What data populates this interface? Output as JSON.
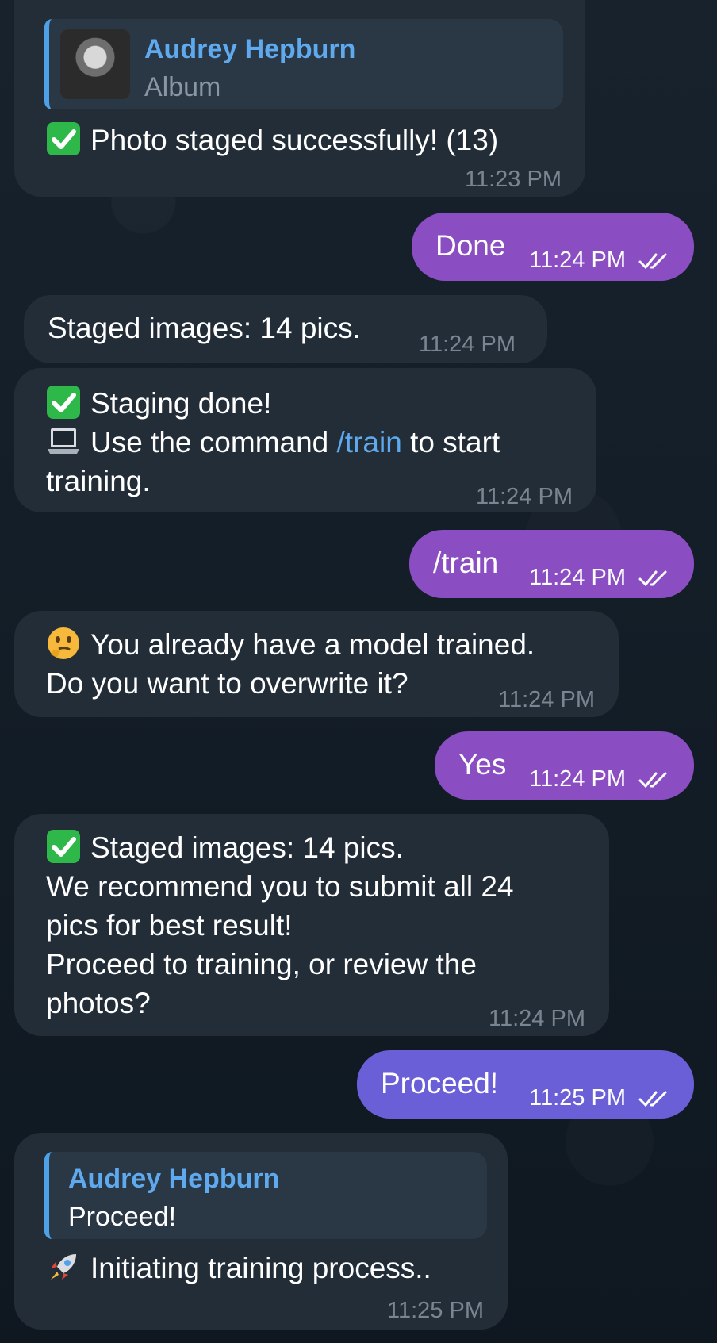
{
  "messages": [
    {
      "id": "m1",
      "reply": {
        "name": "Audrey Hepburn",
        "sub": "Album"
      },
      "emoji": "check-mark",
      "text": "Photo staged successfully! (13)",
      "time": "11:23 PM"
    },
    {
      "id": "m2",
      "text": "Done",
      "time": "11:24 PM"
    },
    {
      "id": "m3",
      "text": "Staged images: 14 pics.",
      "time": "11:24 PM"
    },
    {
      "id": "m4",
      "line1": "Staging done!",
      "line2_pre": "Use the command ",
      "line2_link": "/train",
      "line2_post": " to start",
      "line3": "training.",
      "time": "11:24 PM"
    },
    {
      "id": "m5",
      "text": "/train",
      "time": "11:24 PM"
    },
    {
      "id": "m6",
      "line1": "You already have a model trained.",
      "line2": "Do you want to overwrite it?",
      "time": "11:24 PM"
    },
    {
      "id": "m7",
      "text": "Yes",
      "time": "11:24 PM"
    },
    {
      "id": "m8",
      "line1": "Staged images: 14 pics.",
      "line2": "We recommend you to submit all 24",
      "line3": "pics for best result!",
      "line4": "Proceed to training, or review the",
      "line5": "photos?",
      "time": "11:24 PM"
    },
    {
      "id": "m9",
      "text": "Proceed!",
      "time": "11:25 PM"
    },
    {
      "id": "m10",
      "reply": {
        "name": "Audrey Hepburn",
        "sub": "Proceed!"
      },
      "text": "Initiating training process..",
      "time": "11:25 PM"
    }
  ],
  "colors": {
    "incoming_bubble": "#222d38",
    "outgoing_bubble": "#8a4ec2",
    "outgoing_bubble_alt": "#6b5fd8",
    "link": "#5fa9ee",
    "timestamp": "#7b8591"
  }
}
